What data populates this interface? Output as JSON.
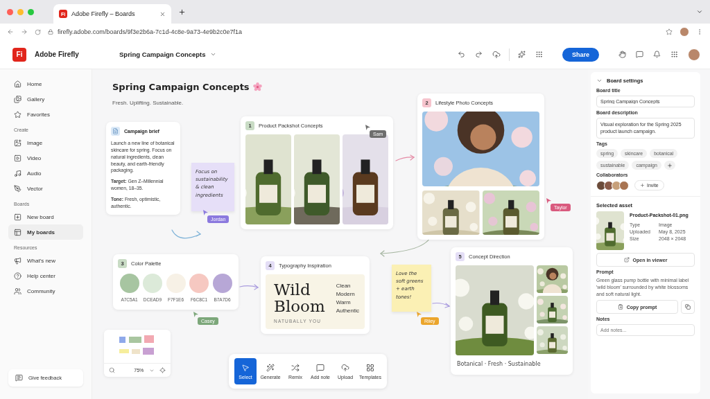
{
  "browser": {
    "favicon": "Fi",
    "tab_title": "Adobe Firefly – Boards",
    "url": "firefly.adobe.com/boards/9f3e2b6a-7c1d-4c8e-9a73-4e9b2c0e7f1a"
  },
  "header": {
    "logo": "Fi",
    "app_name": "Adobe Firefly",
    "board_name": "Spring Campaign Concepts",
    "share": "Share"
  },
  "sidebar": {
    "sections": [
      {
        "items": [
          {
            "label": "Home",
            "selected": false
          },
          {
            "label": "Gallery",
            "selected": false
          },
          {
            "label": "Favorites",
            "selected": false
          }
        ]
      },
      {
        "heading": "Create",
        "items": [
          {
            "label": "Image",
            "selected": false
          },
          {
            "label": "Video",
            "selected": false
          },
          {
            "label": "Audio",
            "selected": false
          },
          {
            "label": "Vector",
            "selected": false
          }
        ]
      },
      {
        "heading": "Boards",
        "items": [
          {
            "label": "New board",
            "selected": false
          },
          {
            "label": "My boards",
            "selected": true
          }
        ]
      },
      {
        "heading": "Resources",
        "items": [
          {
            "label": "What's new",
            "selected": false
          },
          {
            "label": "Help center",
            "selected": false
          },
          {
            "label": "Community",
            "selected": false
          }
        ]
      }
    ],
    "feedback": "Give feedback"
  },
  "canvas": {
    "title": "Spring Campaign Concepts",
    "subtitle": "Fresh. Uplifting. Sustainable.",
    "brief": {
      "title": "Campaign brief",
      "paragraphs": [
        "Launch a new line of botanical skincare for spring. Focus on natural ingredients, clean beauty, and earth-friendly packaging.",
        "**Target:** Gen Z–Millennial women, 18–35.",
        "**Tone:** Fresh, optimistic, authentic."
      ]
    },
    "notes": [
      {
        "text": "Focus on sustainability & clean ingredients",
        "color": "#e6dff8"
      },
      {
        "text": "Love the soft greens + earth tones!",
        "color": "#fbf0b4"
      }
    ],
    "cursors": [
      {
        "name": "Sam",
        "color": "#6e6e6e"
      },
      {
        "name": "Jordan",
        "color": "#8b79de"
      },
      {
        "name": "Taylor",
        "color": "#d95a7e"
      },
      {
        "name": "Casey",
        "color": "#7ca77a"
      },
      {
        "name": "Riley",
        "color": "#eba52c"
      }
    ],
    "cards": [
      {
        "kind": "images",
        "number": "1",
        "title": "Product Packshot Concepts",
        "color": "#c9dcc5"
      },
      {
        "kind": "lifestyle",
        "number": "2",
        "title": "Lifestyle Photo Concepts",
        "color": "#f6c4cd"
      },
      {
        "kind": "palette",
        "number": "3",
        "title": "Color Palette",
        "color": "#c9dcc5",
        "swatches": [
          {
            "label": "A7C5A1",
            "color": "#a7c5a1"
          },
          {
            "label": "DCEAD9",
            "color": "#dcead9"
          },
          {
            "label": "F7F1E6",
            "color": "#f7f1e6"
          },
          {
            "label": "F6C8C1",
            "color": "#f6c8c1"
          },
          {
            "label": "B7A7D6",
            "color": "#b7a7d6"
          }
        ]
      },
      {
        "kind": "typography",
        "number": "4",
        "title": "Typography Inspiration",
        "color": "#e4def6",
        "wordmark": "Wild Bloom",
        "tagline": "NATUBALLY YOU",
        "words": [
          "Clean",
          "Modern",
          "Warm",
          "Authentic"
        ]
      },
      {
        "kind": "concept",
        "number": "5",
        "title": "Concept Direction",
        "color": "#e4def6",
        "caption": "Botanical · Fresh · Sustainable"
      }
    ],
    "minimap": {
      "zoom": "75%"
    },
    "toolbar": [
      {
        "label": "Select",
        "selected": true
      },
      {
        "label": "Generate",
        "selected": false
      },
      {
        "label": "Remix",
        "selected": false
      },
      {
        "label": "Add note",
        "selected": false
      },
      {
        "label": "Upload",
        "selected": false
      },
      {
        "label": "Templates",
        "selected": false
      }
    ]
  },
  "panel": {
    "heading": "Board settings",
    "title_label": "Board title",
    "title_value": "Spring Campaign Concepts",
    "description_label": "Board description",
    "description_value": "Visual exploration for the Spring 2025 product launch campaign.",
    "tags_label": "Tags",
    "tags": [
      "spring",
      "skincare",
      "botanical",
      "sustainable",
      "campaign"
    ],
    "collaborators_label": "Collaborators",
    "invite": "Invite",
    "asset_heading": "Selected asset",
    "file_name": "Product-Packshot-01.png",
    "meta": [
      {
        "label": "Type",
        "value": "Image"
      },
      {
        "label": "Uploaded",
        "value": "May 8, 2025"
      },
      {
        "label": "Size",
        "value": "2048 × 2048"
      }
    ],
    "open": "Open in viewer",
    "prompt_label": "Prompt",
    "prompt": "Green glass pump bottle with minimal label 'wild bloom' surrounded by white blossoms and soft natural light.",
    "copy": "Copy prompt",
    "notes_label": "Notes",
    "notes_placeholder": "Add notes..."
  }
}
